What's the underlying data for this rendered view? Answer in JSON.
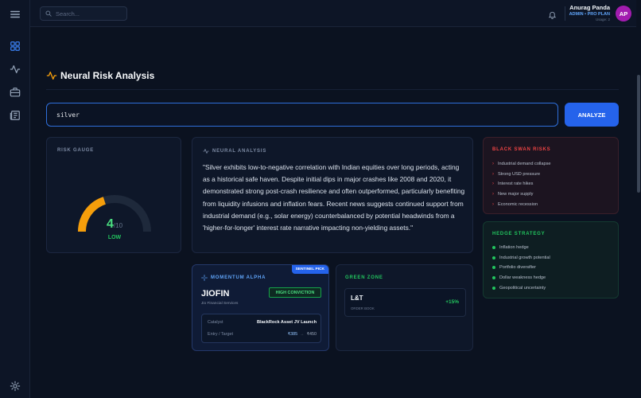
{
  "header": {
    "search_placeholder": "Search...",
    "user": {
      "name": "Anurag Panda",
      "role": "ADMIN • PRO PLAN",
      "usage": "Usage: 2",
      "initials": "AP"
    }
  },
  "page": {
    "title": "Neural Risk Analysis"
  },
  "query": {
    "value": "silver",
    "button_label": "ANALYZE"
  },
  "risk_gauge": {
    "label": "RISK GAUGE",
    "score": "4",
    "denominator": "/10",
    "score_value": 4,
    "max": 10,
    "level": "LOW"
  },
  "neural_analysis": {
    "label": "NEURAL ANALYSIS",
    "text": "\"Silver exhibits low-to-negative correlation with Indian equities over long periods, acting as a historical safe haven. Despite initial dips in major crashes like 2008 and 2020, it demonstrated strong post-crash resilience and often outperformed, particularly benefiting from liquidity infusions and inflation fears. Recent news suggests continued support from industrial demand (e.g., solar energy) counterbalanced by potential headwinds from a 'higher-for-longer' interest rate narrative impacting non-yielding assets.\""
  },
  "black_swan": {
    "label": "BLACK SWAN RISKS",
    "items": [
      "Industrial demand collapse",
      "Strong USD pressure",
      "Interest rate hikes",
      "New major supply",
      "Economic recession"
    ]
  },
  "hedge_strategy": {
    "label": "HEDGE STRATEGY",
    "items": [
      "Inflation hedge",
      "Industrial growth potential",
      "Portfolio diversifier",
      "Dollar weakness hedge",
      "Geopolitical uncertainty"
    ]
  },
  "momentum": {
    "label": "MOMENTUM ALPHA",
    "tag": "SENTINEL PICK",
    "ticker": "JIOFIN",
    "company": "Jio Financial Services",
    "conviction": "HIGH CONVICTION",
    "catalyst_label": "Catalyst",
    "catalyst_value": "BlackRock Asset JV Launch",
    "entry_label": "Entry / Target",
    "entry": "₹385",
    "arrow": "→",
    "target": "₹450"
  },
  "green_zone": {
    "label": "GREEN ZONE",
    "ticker": "L&T",
    "sub": "ORDER BOOK",
    "change": "+15%"
  },
  "colors": {
    "accent": "#2563eb",
    "gauge_fill": "#f59e0b",
    "gauge_track": "#1e293b",
    "positive": "#22c55e",
    "danger": "#ef4444"
  }
}
